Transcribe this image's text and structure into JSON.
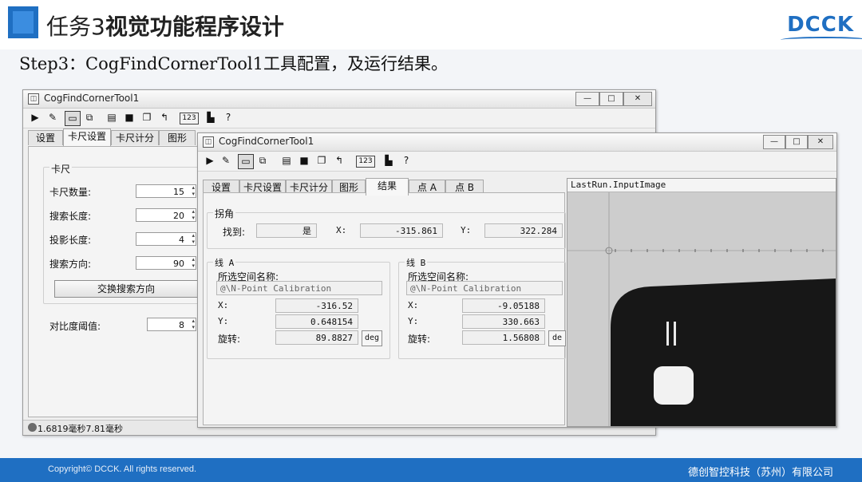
{
  "slide": {
    "title_normal": "任务3",
    "title_bold": "视觉功能程序设计",
    "logo": "DCCK",
    "step": "Step3：CogFindCornerTool1工具配置，及运行结果。"
  },
  "footer": {
    "copyright": "Copyright© DCCK. All rights reserved.",
    "company": "德创智控科技（苏州）有限公司"
  },
  "window_controls": {
    "minimize": "—",
    "maximize": "□",
    "close": "✕"
  },
  "toolbar_icons": [
    "run-icon",
    "edit-icon",
    "display-icon",
    "copy-icon",
    "open-icon",
    "save-icon",
    "cascade-icon",
    "reset-icon",
    "numeric-icon",
    "chart-icon",
    "help-icon"
  ],
  "toolbar_glyphs": {
    "run": "▶",
    "edit": "✎",
    "display": "▭",
    "copy": "⧉",
    "open": "▤",
    "save": "■",
    "cascade": "❐",
    "reset": "↰",
    "numeric": "123",
    "chart": "▙",
    "help": "?"
  },
  "win1": {
    "title": "CogFindCornerTool1",
    "tabs": [
      "设置",
      "卡尺设置",
      "卡尺计分",
      "图形"
    ],
    "active_tab": "卡尺设置",
    "group_label": "卡尺",
    "fields": [
      {
        "label": "卡尺数量:",
        "value": "15"
      },
      {
        "label": "搜索长度:",
        "value": "20"
      },
      {
        "label": "投影长度:",
        "value": "4"
      },
      {
        "label": "搜索方向:",
        "value": "90"
      }
    ],
    "swap_button": "交换搜索方向",
    "contrast_label": "对比度阈值:",
    "contrast_value": "8",
    "status": "1.6819毫秒7.81毫秒"
  },
  "win2": {
    "title": "CogFindCornerTool1",
    "tabs": [
      "设置",
      "卡尺设置",
      "卡尺计分",
      "图形",
      "结果",
      "点 A",
      "点 B"
    ],
    "active_tab": "结果",
    "corner_group": "拐角",
    "found_label": "找到:",
    "found_value": "是",
    "x_label": "X:",
    "x_value": "-315.861",
    "y_label": "Y:",
    "y_value": "322.284",
    "lineA": {
      "group": "线 A",
      "space_label": "所选空间名称:",
      "space_value": "@\\N-Point Calibration",
      "x": "-316.52",
      "y": "0.648154",
      "rot_label": "旋转:",
      "rot": "89.8827",
      "unit": "deg"
    },
    "lineB": {
      "group": "线 B",
      "space_label": "所选空间名称:",
      "space_value": "@\\N-Point Calibration",
      "x": "-9.05188",
      "y": "330.663",
      "rot_label": "旋转:",
      "rot": "1.56808",
      "unit": "de"
    },
    "image_title": "LastRun.InputImage"
  }
}
